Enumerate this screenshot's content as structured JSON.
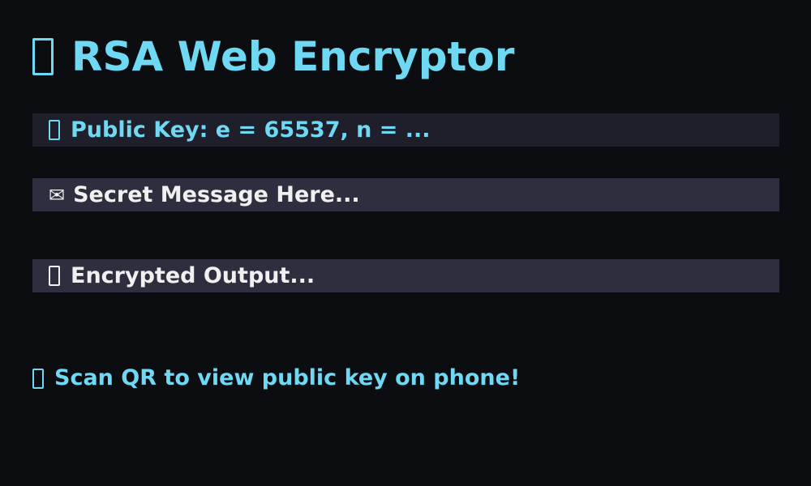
{
  "header": {
    "title": "RSA Web Encryptor",
    "icon": "lock-icon"
  },
  "public_key": {
    "icon": "key-icon",
    "text": "Public Key: e = 65537, n = ..."
  },
  "message_input": {
    "icon": "envelope-icon",
    "icon_glyph": "✉",
    "placeholder": "Secret Message Here..."
  },
  "encrypted_output": {
    "icon": "lock-closed-icon",
    "text": "Encrypted Output..."
  },
  "qr_note": {
    "icon": "phone-icon",
    "text": "Scan QR to view public key on phone!"
  },
  "colors": {
    "background": "#0c0d11",
    "accent": "#6fd8f2",
    "bar_dark": "#1f1f2b",
    "bar_light": "#2e2e3e",
    "text_light": "#f0f0f0"
  }
}
